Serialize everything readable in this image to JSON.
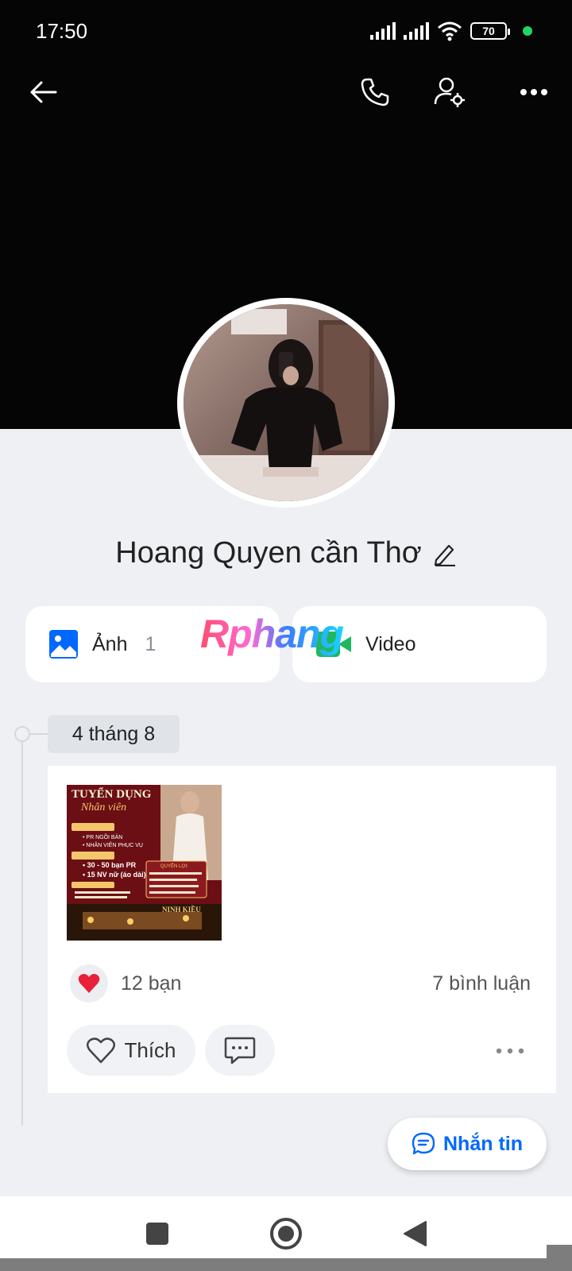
{
  "status_bar": {
    "time": "17:50",
    "battery_level": "70"
  },
  "top_bar": {
    "icons": [
      "back-arrow-icon",
      "phone-icon",
      "user-settings-icon",
      "more-icon"
    ]
  },
  "profile": {
    "name": "Hoang Quyen cần Thơ"
  },
  "media": {
    "photos_label": "Ảnh",
    "photos_count": "1",
    "video_label": "Video"
  },
  "watermark": {
    "text": "Rphang"
  },
  "timeline": {
    "date": "4 tháng 8",
    "post": {
      "image_lines": {
        "title1": "TUYỂN DỤNG",
        "title2": "Nhân viên",
        "pr": "• PR NGỒI BÀN",
        "service": "• NHÂN VIÊN PHỤC VỤ",
        "qty1": "• 30 - 50 bạn PR",
        "qty2": "• 15 NV nữ (áo dài)",
        "benefits": "QUYỀN LỢI:",
        "brand": "NINH KIỀU"
      },
      "reactions_label": "12 bạn",
      "comments_label": "7 bình luận",
      "like_label": "Thích"
    }
  },
  "message_button": {
    "label": "Nhắn tin"
  },
  "colors": {
    "accent": "#0068ff",
    "heart": "#e8203a",
    "cover": "#050505"
  }
}
